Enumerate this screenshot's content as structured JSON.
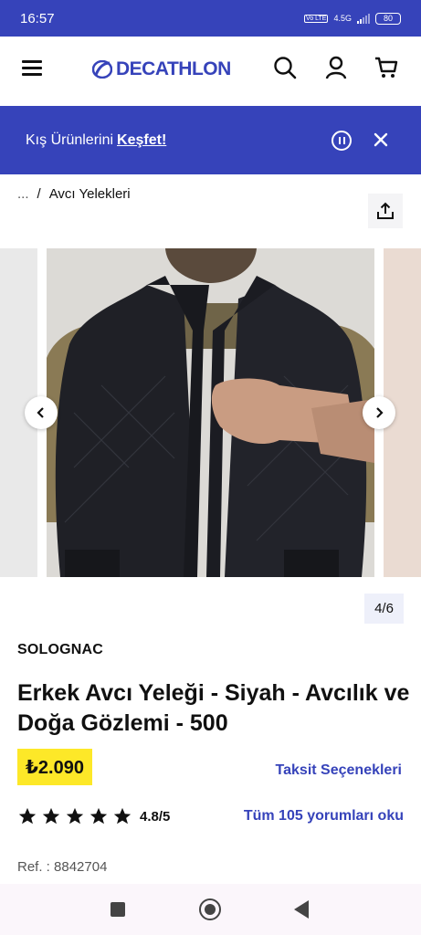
{
  "status_bar": {
    "time": "16:57",
    "network": "4.5G",
    "lte": "Vo LTE",
    "battery": "80"
  },
  "header": {
    "logo_text": "DECATHLON",
    "brand_color": "#3643ba"
  },
  "banner": {
    "text": "Kış Ürünlerini",
    "link": "Keşfet!"
  },
  "breadcrumb": {
    "ellipsis": "...",
    "separator": "/",
    "current": "Avcı Yelekleri"
  },
  "gallery": {
    "counter": "4/6"
  },
  "product": {
    "brand": "SOLOGNAC",
    "title": "Erkek Avcı Yeleği - Siyah - Avcılık ve Doğa Gözlemi - 500",
    "price": "₺2.090",
    "installments": "Taksit Seçenekleri",
    "rating": "4.8/5",
    "reviews_link": "Tüm 105 yorumları oku",
    "ref": "Ref. : 8842704"
  },
  "colors": {
    "accent": "#3643ba",
    "price_bg": "#fde828"
  }
}
